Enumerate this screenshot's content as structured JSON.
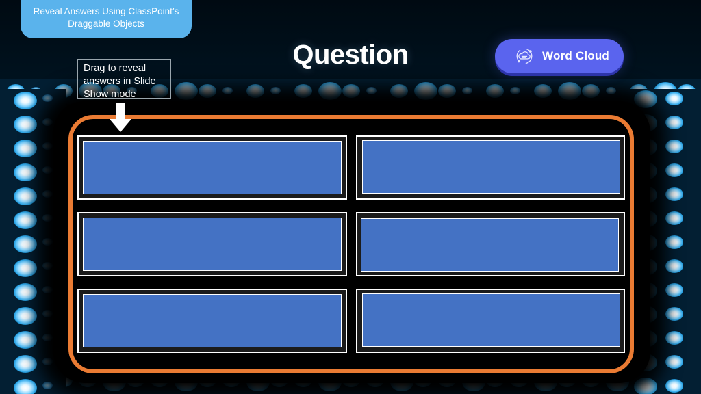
{
  "slide": {
    "background_color": "#001320",
    "stage_color": "#000000",
    "accent_orange": "#EA7B33",
    "answer_fill_color": "#4472C4",
    "badge_color": "#5AB3EC",
    "button_color": "#5A64EE",
    "bulb_color": "#8FD8FF"
  },
  "header_badge": {
    "text": "Reveal Answers Using ClassPoint’s Draggable Objects"
  },
  "title": {
    "text": "Question"
  },
  "tooltip": {
    "text": "Drag to reveal answers in Slide Show mode",
    "arrow_icon": "arrow-down-icon"
  },
  "word_cloud_button": {
    "label": "Word Cloud",
    "icon": "word-cloud-icon"
  },
  "answers": {
    "count": 6,
    "items": [
      {
        "id": "answer-1",
        "label": "",
        "fill": "#4472C4"
      },
      {
        "id": "answer-2",
        "label": "",
        "fill": "#4472C4"
      },
      {
        "id": "answer-3",
        "label": "",
        "fill": "#4472C4"
      },
      {
        "id": "answer-4",
        "label": "",
        "fill": "#4472C4"
      },
      {
        "id": "answer-5",
        "label": "",
        "fill": "#4472C4"
      },
      {
        "id": "answer-6",
        "label": "",
        "fill": "#4472C4"
      }
    ]
  }
}
